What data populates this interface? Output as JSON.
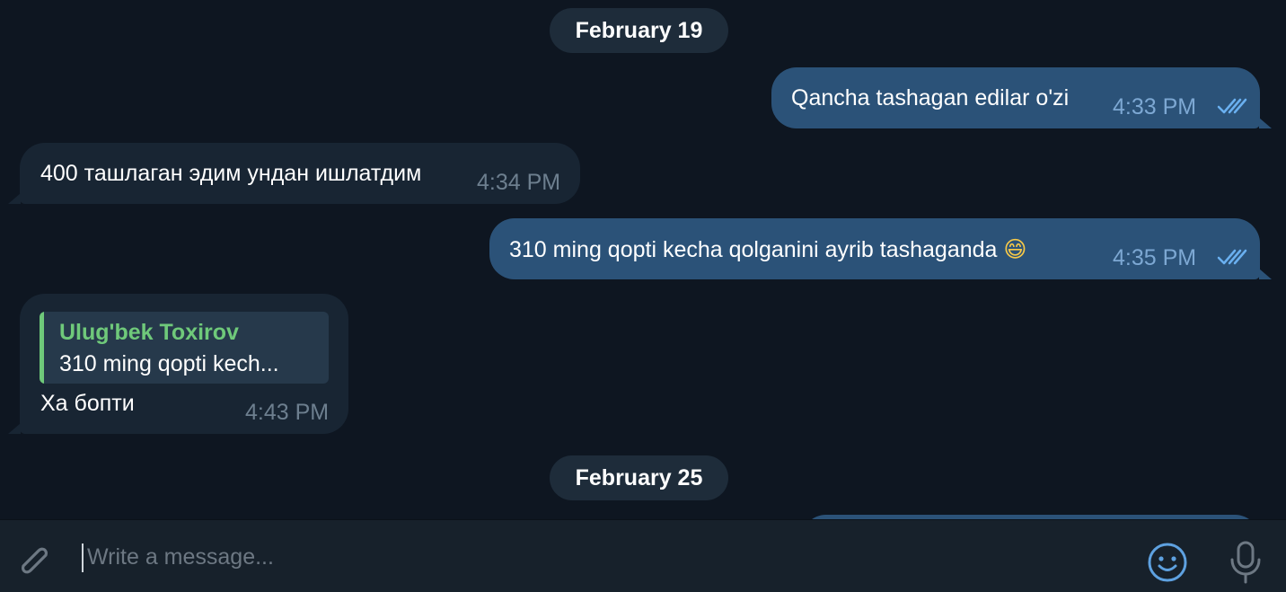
{
  "dates": [
    "February 19",
    "February 25"
  ],
  "messages": [
    {
      "direction": "out",
      "text": "Qancha tashagan edilar o'zi",
      "time": "4:33 PM",
      "status": "read"
    },
    {
      "direction": "in",
      "text": "400 ташлаган эдим ундан ишлатдим",
      "time": "4:34 PM"
    },
    {
      "direction": "out",
      "text": "310 ming qopti  kecha qolganini ayrib tashaganda",
      "emoji": "😄",
      "time": "4:35 PM",
      "status": "read"
    },
    {
      "direction": "in",
      "reply": {
        "author": "Ulug'bek Toxirov",
        "preview": "310 ming qopti  kech..."
      },
      "text": "Ха бопти",
      "time": "4:43 PM"
    }
  ],
  "composer": {
    "placeholder": "Write a message..."
  },
  "icons": {
    "attach": "paperclip-icon",
    "emoji": "smile-icon",
    "voice": "microphone-icon",
    "read": "double-check-icon"
  },
  "colors": {
    "background": "#0e1621",
    "outgoing": "#2b5278",
    "incoming": "#182533",
    "reply_accent": "#6fc97a",
    "emoji_icon": "#5ea1e0"
  }
}
